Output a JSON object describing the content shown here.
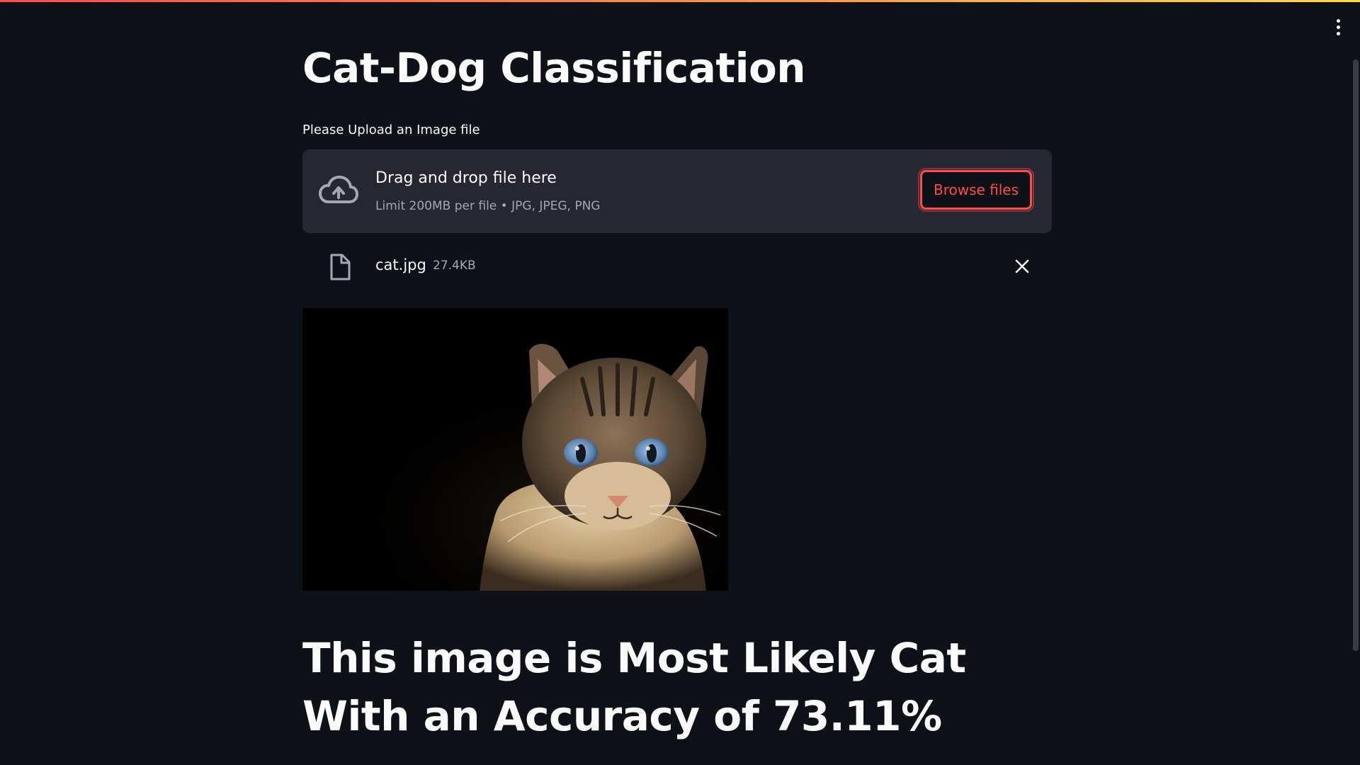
{
  "app": {
    "title": "Cat-Dog Classification"
  },
  "uploader": {
    "label": "Please Upload an Image file",
    "drop_text": "Drag and drop file here",
    "limit_text": "Limit 200MB per file • JPG, JPEG, PNG",
    "browse_label": "Browse files",
    "icon": "cloud-upload-icon"
  },
  "uploaded_file": {
    "name": "cat.jpg",
    "size": "27.4KB",
    "icon": "file-icon"
  },
  "image": {
    "description_icon": "cat-photo"
  },
  "result": {
    "text": "This image is Most Likely Cat With an Accuracy of 73.11%"
  },
  "colors": {
    "background": "#0e1117",
    "surface": "#262730",
    "accent": "#ff4b4b",
    "muted_text": "#a3a8b8"
  }
}
